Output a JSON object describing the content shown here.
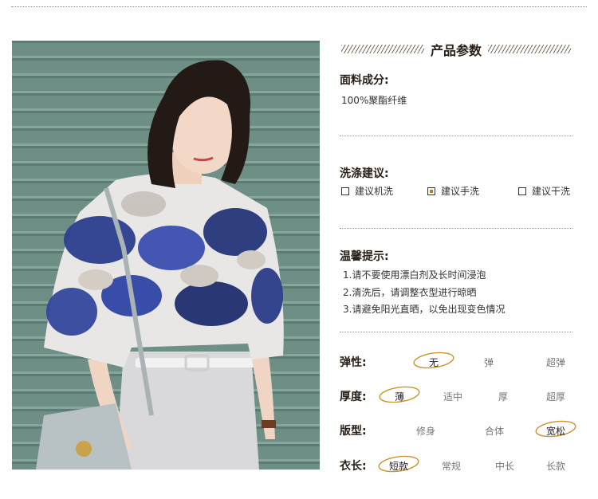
{
  "heading": "产品参数",
  "fabric": {
    "title": "面料成分:",
    "value": "100%聚酯纤维"
  },
  "wash": {
    "title": "洗涤建议:",
    "options": [
      {
        "label": "建议机洗",
        "selected": false
      },
      {
        "label": "建议手洗",
        "selected": true
      },
      {
        "label": "建议干洗",
        "selected": false
      }
    ]
  },
  "tips": {
    "title": "温馨提示:",
    "lines": [
      "1.请不要使用漂白剂及长时间浸泡",
      "2.清洗后，请调整衣型进行晾晒",
      "3.请避免阳光直晒，以免出现变色情况"
    ]
  },
  "attributes": [
    {
      "label": "弹性:",
      "options": [
        "无",
        "弹",
        "超弹"
      ],
      "selected": 0
    },
    {
      "label": "厚度:",
      "options": [
        "薄",
        "适中",
        "厚",
        "超厚"
      ],
      "selected": 0
    },
    {
      "label": "版型:",
      "options": [
        "修身",
        "合体",
        "宽松"
      ],
      "selected": 2
    },
    {
      "label": "衣长:",
      "options": [
        "短款",
        "常规",
        "中长",
        "长款"
      ],
      "selected": 0
    }
  ],
  "colors": {
    "accent": "#c8952e",
    "text": "#2b2018",
    "muted": "#777777"
  }
}
